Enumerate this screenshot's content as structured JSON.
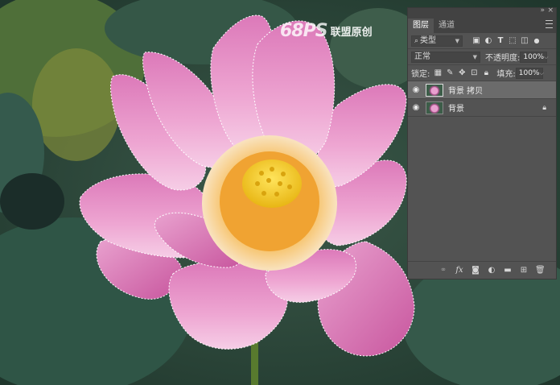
{
  "watermark": {
    "logo": "68PS",
    "text": "联盟原创"
  },
  "panel": {
    "tabs": [
      {
        "label": "图层"
      },
      {
        "label": "通道"
      }
    ],
    "filter": {
      "value": "类型"
    },
    "blend_mode": {
      "value": "正常"
    },
    "opacity": {
      "label": "不透明度:",
      "value": "100%"
    },
    "lock": {
      "label": "锁定:"
    },
    "fill": {
      "label": "填充:",
      "value": "100%"
    },
    "layers": [
      {
        "name": "背景 拷贝",
        "selected": true
      },
      {
        "name": "背景",
        "locked": true
      }
    ]
  },
  "colors": {
    "panel_bg": "#535353",
    "selected_layer": "#6b6b6b",
    "petal": "#e48ec6",
    "pod": "#f3cf2d"
  }
}
